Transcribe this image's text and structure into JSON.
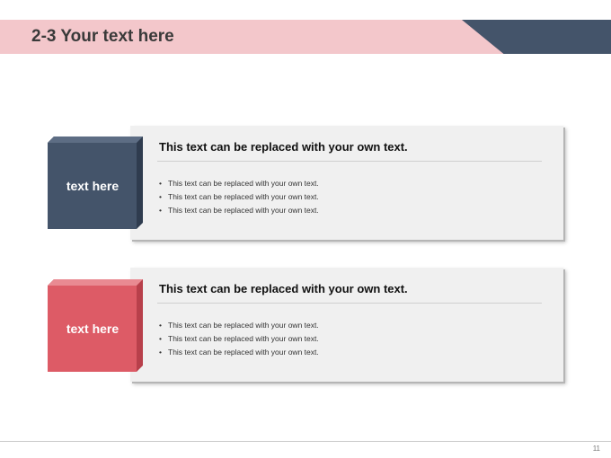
{
  "slide": {
    "title": "2-3 Your text here",
    "page_number": "11"
  },
  "colors": {
    "title_band": "#f3c7cb",
    "title_dark": "#44546a",
    "box_navy": "#44546a",
    "box_red": "#dd5b66",
    "card_bg": "#f0f0f0"
  },
  "items": [
    {
      "label": "text here",
      "heading": "This text can be replaced with your own text.",
      "bullets": [
        "This text can be replaced with your own text.",
        "This text can be replaced with your own text.",
        "This text can be replaced with your own text."
      ]
    },
    {
      "label": "text here",
      "heading": "This text can be replaced with your own text.",
      "bullets": [
        "This text can be replaced with your own text.",
        "This text can be replaced with your own text.",
        "This text can be replaced with your own text."
      ]
    }
  ]
}
